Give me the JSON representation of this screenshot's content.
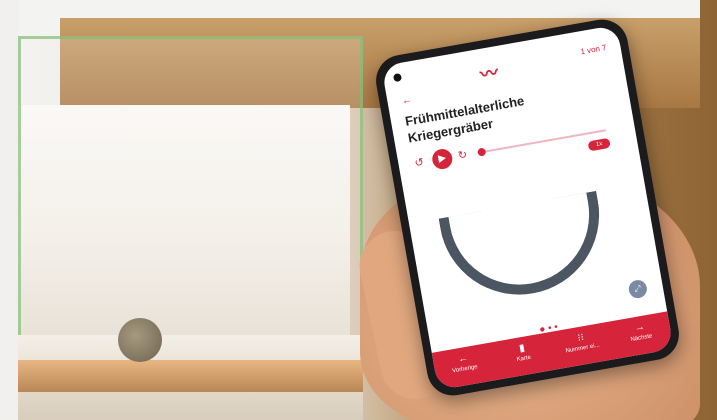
{
  "app": {
    "counter": "1 von 7",
    "back_label": "←",
    "title": "Frühmittelalterliche Kriegergräber",
    "player": {
      "play_icon": "play-icon",
      "rewind_icon": "rewind-icon",
      "forward_icon": "forward-icon",
      "progress": 0.05,
      "speed_label": "1x"
    },
    "page_dots": "● • •",
    "bottom_nav": [
      {
        "label": "Vorherige",
        "icon": "arrow-left-icon",
        "glyph": "←"
      },
      {
        "label": "Karte",
        "icon": "map-icon",
        "glyph": "▮"
      },
      {
        "label": "Nummer ei...",
        "icon": "keypad-icon",
        "glyph": "⁝⁝"
      },
      {
        "label": "Nächste",
        "icon": "arrow-right-icon",
        "glyph": "→"
      }
    ]
  },
  "colors": {
    "accent": "#d6243b"
  }
}
